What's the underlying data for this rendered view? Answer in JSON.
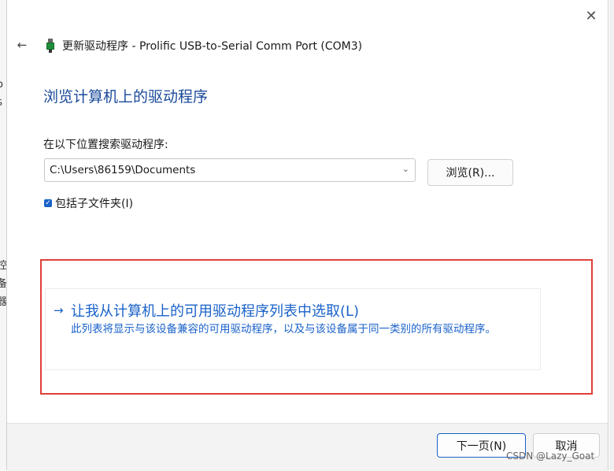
{
  "background": {
    "left_glyphs": [
      "o",
      "S",
      "控",
      "备",
      "器"
    ]
  },
  "dialog": {
    "title": "更新驱动程序 - Prolific USB-to-Serial Comm Port (COM3)",
    "close_icon": "close-icon",
    "back_icon": "back-arrow-icon",
    "device_icon": "usb-device-icon"
  },
  "main": {
    "heading": "浏览计算机上的驱动程序",
    "search_label": "在以下位置搜索驱动程序:",
    "path_value": "C:\\Users\\86159\\Documents",
    "browse_label": "浏览(R)...",
    "include_subfolders_label": "包括子文件夹(I)",
    "include_subfolders_checked": true
  },
  "pick_option": {
    "arrow": "→",
    "title": "让我从计算机上的可用驱动程序列表中选取(L)",
    "description": "此列表将显示与该设备兼容的可用驱动程序，以及与该设备属于同一类别的所有驱动程序。"
  },
  "footer": {
    "next_label": "下一页(N)",
    "cancel_label": "取消"
  },
  "watermark": "CSDN @Lazy_Goat",
  "colors": {
    "accent": "#1a62c9",
    "heading": "#1a4a9a",
    "highlight_outline": "#e0403a"
  }
}
